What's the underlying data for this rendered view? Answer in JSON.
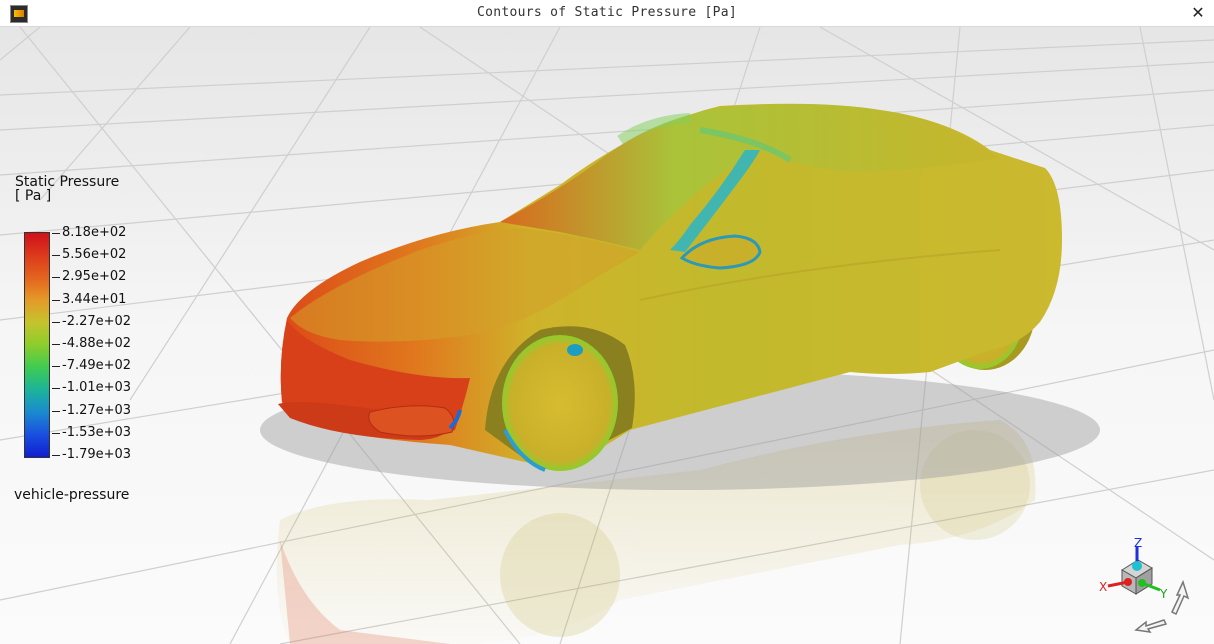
{
  "window": {
    "title": "Contours of Static Pressure [Pa]",
    "close_label": "✕"
  },
  "legend": {
    "title_line1": "Static Pressure",
    "title_line2": "[ Pa ]",
    "labels": [
      "8.18e+02",
      "5.56e+02",
      "2.95e+02",
      "3.44e+01",
      "-2.27e+02",
      "-4.88e+02",
      "-7.49e+02",
      "-1.01e+03",
      "-1.27e+03",
      "-1.53e+03",
      "-1.79e+03"
    ],
    "colors": [
      "#d0101a",
      "#dc3a1c",
      "#e3641e",
      "#e49a28",
      "#c5c32d",
      "#8ccd2c",
      "#3fcb52",
      "#1cb39a",
      "#1a8ad0",
      "#1a4fe0",
      "#0f1fd0"
    ]
  },
  "case_label": "vehicle-pressure",
  "triad": {
    "x": "X",
    "y": "Y",
    "z": "Z"
  }
}
